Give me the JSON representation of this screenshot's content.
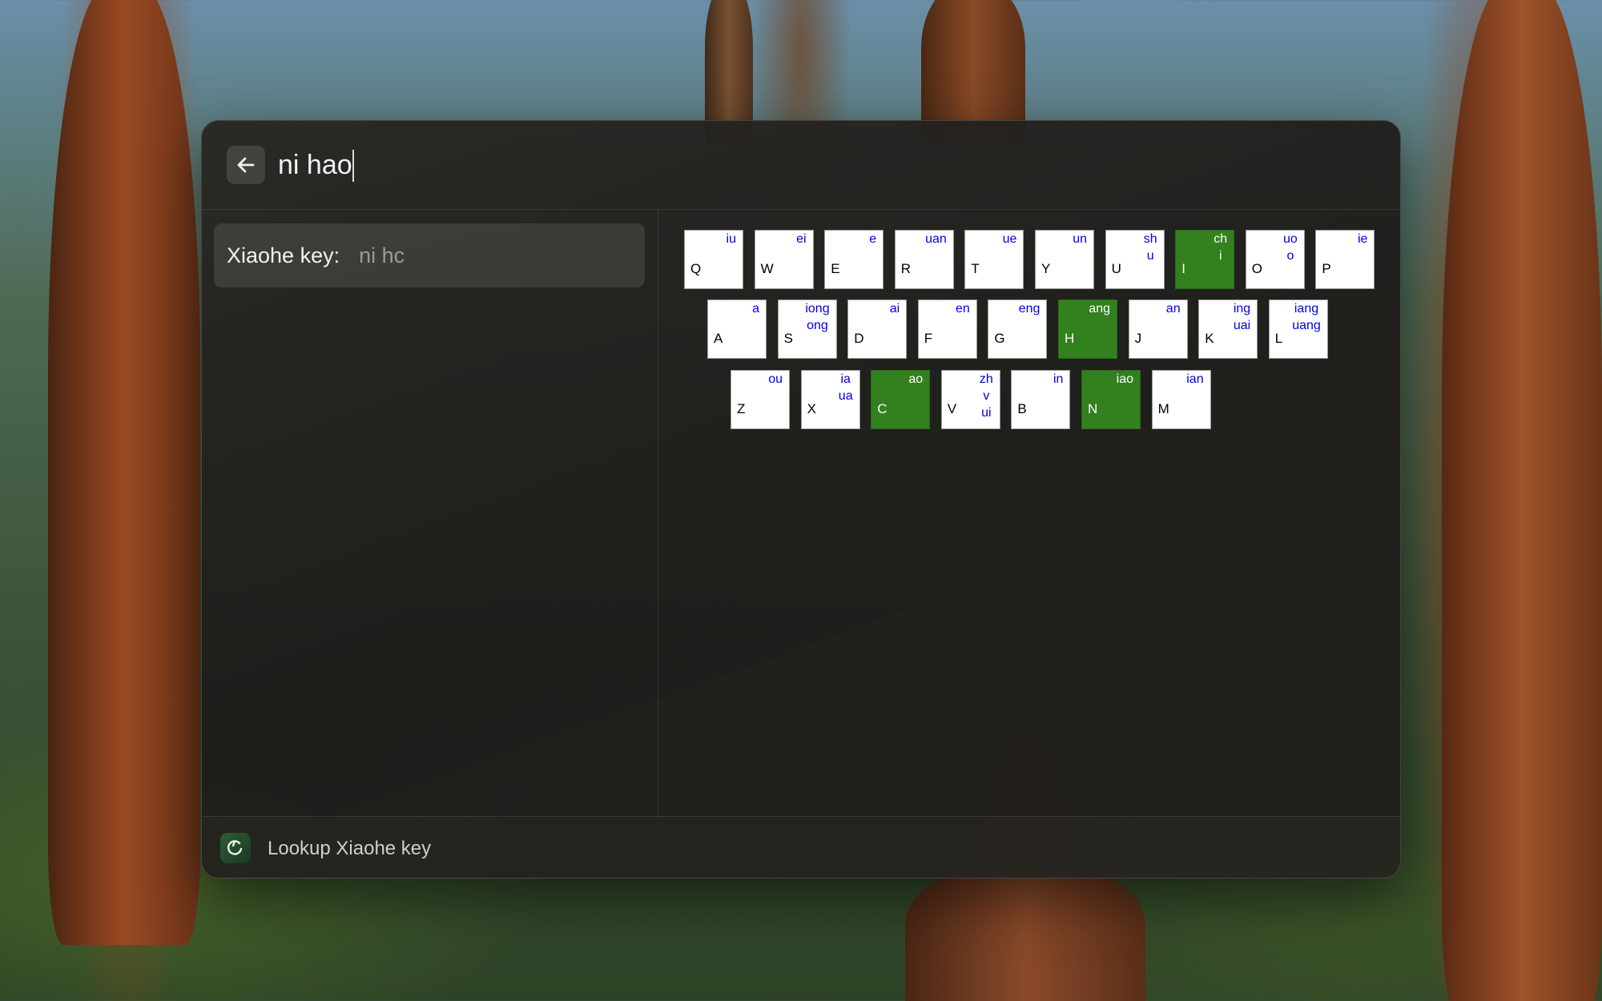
{
  "search": {
    "value": "ni hao"
  },
  "result": {
    "label": "Xiaohe key:",
    "value": "ni hc"
  },
  "keyboard": {
    "rows": [
      [
        {
          "key": "Q",
          "sub": [
            "iu"
          ],
          "active": false
        },
        {
          "key": "W",
          "sub": [
            "ei"
          ],
          "active": false
        },
        {
          "key": "E",
          "sub": [
            "e"
          ],
          "active": false
        },
        {
          "key": "R",
          "sub": [
            "uan"
          ],
          "active": false
        },
        {
          "key": "T",
          "sub": [
            "ue"
          ],
          "active": false
        },
        {
          "key": "Y",
          "sub": [
            "un"
          ],
          "active": false
        },
        {
          "key": "U",
          "sub": [
            "sh",
            "u"
          ],
          "active": false
        },
        {
          "key": "I",
          "sub": [
            "ch",
            "i"
          ],
          "active": true
        },
        {
          "key": "O",
          "sub": [
            "uo",
            "o"
          ],
          "active": false
        },
        {
          "key": "P",
          "sub": [
            "ie"
          ],
          "active": false
        }
      ],
      [
        {
          "key": "A",
          "sub": [
            "a"
          ],
          "active": false
        },
        {
          "key": "S",
          "sub": [
            "iong",
            "ong"
          ],
          "active": false
        },
        {
          "key": "D",
          "sub": [
            "ai"
          ],
          "active": false
        },
        {
          "key": "F",
          "sub": [
            "en"
          ],
          "active": false
        },
        {
          "key": "G",
          "sub": [
            "eng"
          ],
          "active": false
        },
        {
          "key": "H",
          "sub": [
            "ang"
          ],
          "active": true
        },
        {
          "key": "J",
          "sub": [
            "an"
          ],
          "active": false
        },
        {
          "key": "K",
          "sub": [
            "ing",
            "uai"
          ],
          "active": false
        },
        {
          "key": "L",
          "sub": [
            "iang",
            "uang"
          ],
          "active": false
        }
      ],
      [
        {
          "key": "Z",
          "sub": [
            "ou"
          ],
          "active": false
        },
        {
          "key": "X",
          "sub": [
            "ia",
            "ua"
          ],
          "active": false
        },
        {
          "key": "C",
          "sub": [
            "ao"
          ],
          "active": true
        },
        {
          "key": "V",
          "sub": [
            "zh",
            "v",
            "ui"
          ],
          "active": false
        },
        {
          "key": "B",
          "sub": [
            "in"
          ],
          "active": false
        },
        {
          "key": "N",
          "sub": [
            "iao"
          ],
          "active": true
        },
        {
          "key": "M",
          "sub": [
            "ian"
          ],
          "active": false
        }
      ]
    ],
    "colors": {
      "active": "#32801e",
      "key": "#ffffff",
      "final": "#0000e6"
    }
  },
  "footer": {
    "label": "Lookup Xiaohe key",
    "icon": "xiaohe-extension-icon"
  },
  "back": {
    "icon": "arrow-left-icon"
  }
}
